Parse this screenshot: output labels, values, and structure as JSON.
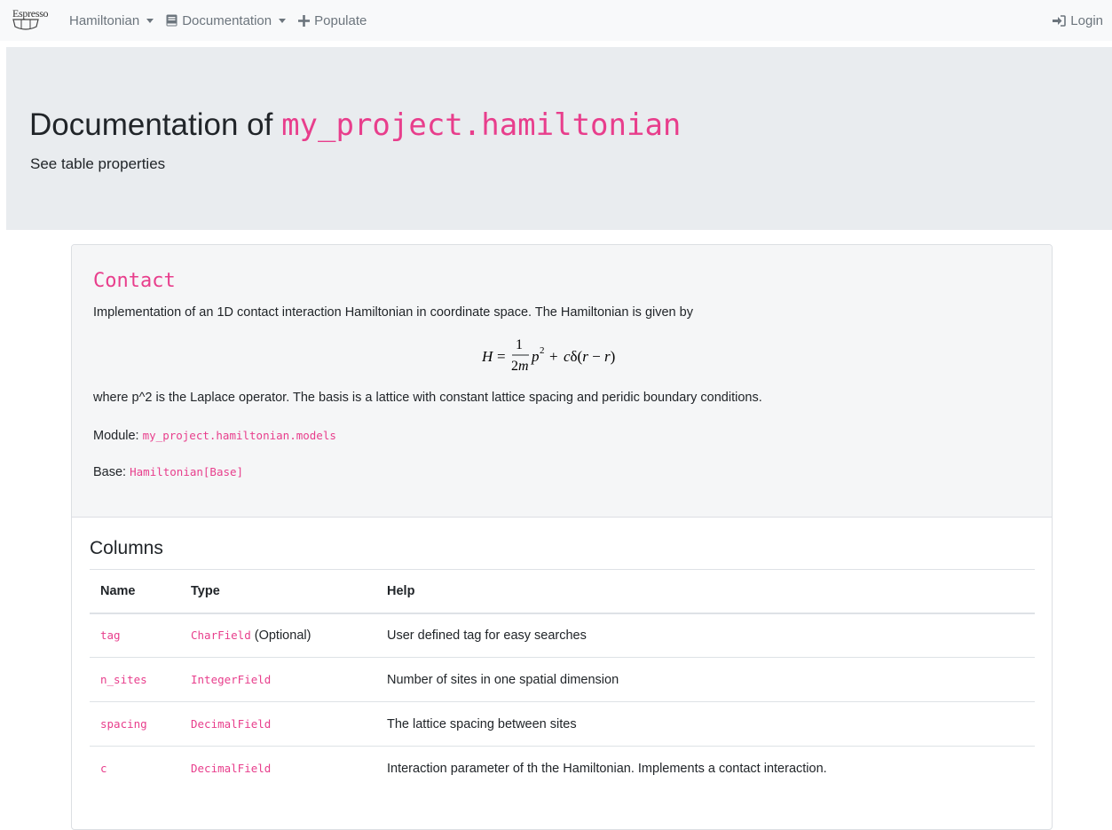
{
  "navbar": {
    "brand": "Espresso",
    "items": [
      {
        "label": "Hamiltonian",
        "dropdown": true,
        "icon": ""
      },
      {
        "label": "Documentation",
        "dropdown": true,
        "icon": "book-icon"
      },
      {
        "label": "Populate",
        "dropdown": false,
        "icon": "plus-icon"
      }
    ],
    "login": "Login"
  },
  "header": {
    "title_prefix": "Documentation of",
    "title_module": "my_project.hamiltonian",
    "subtitle": "See table properties"
  },
  "model": {
    "name": "Contact",
    "description": "Implementation of an 1D contact interaction Hamiltonian in coordinate space. The Hamiltonian is given by",
    "formula": "H = 1/(2m) p^2 + cδ(r − r)",
    "where_text": "where p^2 is the Laplace operator. The basis is a lattice with constant lattice spacing and peridic boundary conditions.",
    "module_label": "Module:",
    "module": "my_project.hamiltonian.models",
    "base_label": "Base:",
    "base": "Hamiltonian[Base]"
  },
  "columns": {
    "title": "Columns",
    "headers": [
      "Name",
      "Type",
      "Help"
    ],
    "rows": [
      {
        "name": "tag",
        "type": "CharField",
        "type_suffix": " (Optional)",
        "help": "User defined tag for easy searches"
      },
      {
        "name": "n_sites",
        "type": "IntegerField",
        "type_suffix": "",
        "help": "Number of sites in one spatial dimension"
      },
      {
        "name": "spacing",
        "type": "DecimalField",
        "type_suffix": "",
        "help": "The lattice spacing between sites"
      },
      {
        "name": "c",
        "type": "DecimalField",
        "type_suffix": "",
        "help": "Interaction parameter of th the Hamiltonian. Implements a contact interaction."
      }
    ]
  },
  "colors": {
    "accent": "#e83e8c",
    "navbar_bg": "#f8f9fa",
    "jumbotron_bg": "#e9ecef"
  }
}
